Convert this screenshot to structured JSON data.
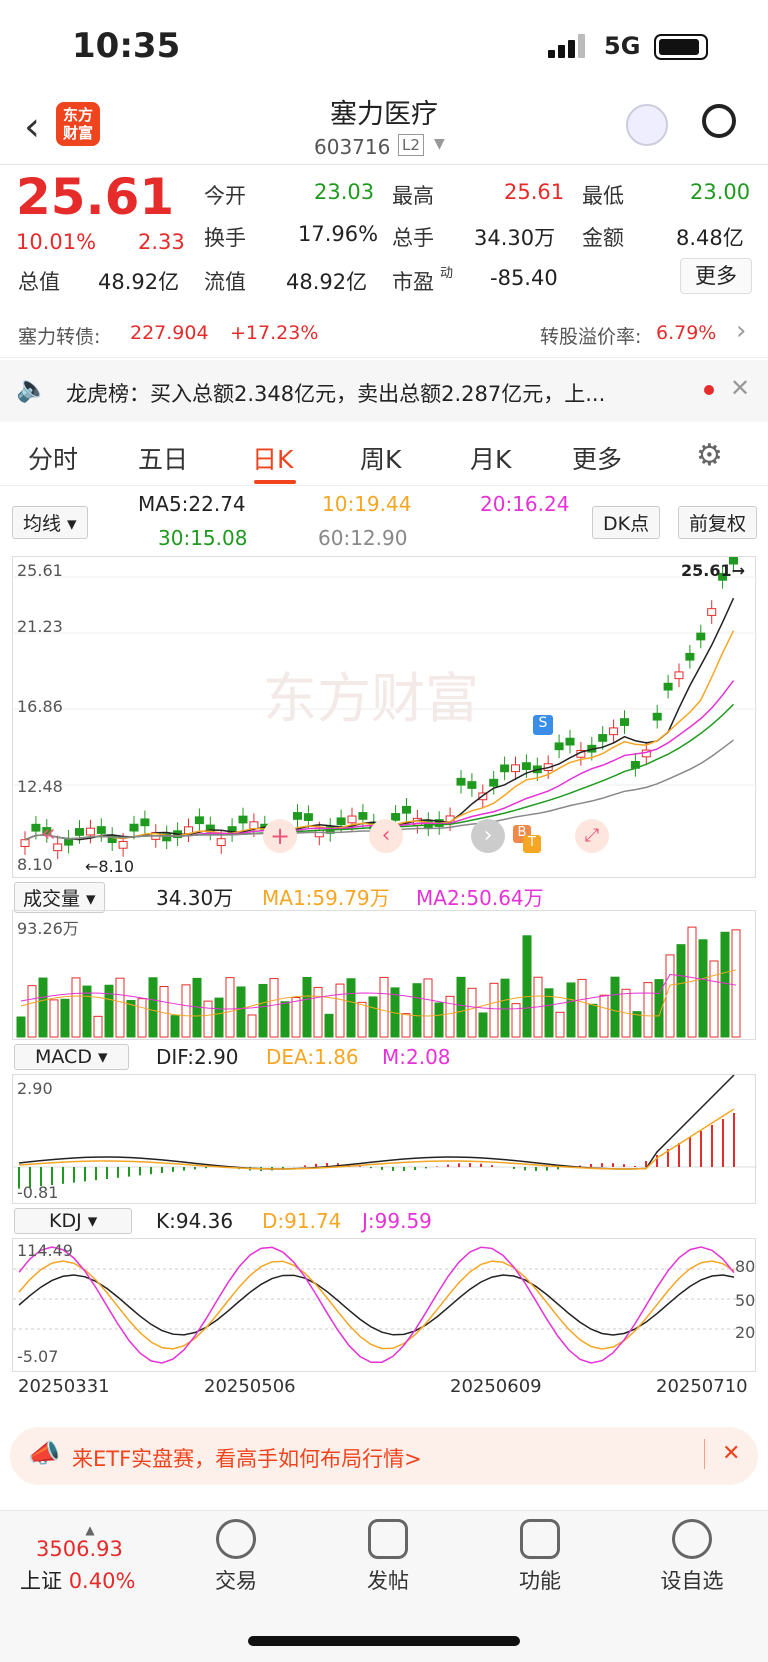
{
  "status": {
    "time": "10:35",
    "network": "5G"
  },
  "header": {
    "title": "塞力医疗",
    "code": "603716",
    "level": "L2",
    "logo": "东方财富",
    "robot_icon": "robot-avatar-icon"
  },
  "quote": {
    "price": "25.61",
    "pct": "10.01%",
    "chg": "2.33",
    "open_label": "今开",
    "open": "23.03",
    "high_label": "最高",
    "high": "25.61",
    "low_label": "最低",
    "low": "23.00",
    "turnover_label": "换手",
    "turnover": "17.96%",
    "vol_label": "总手",
    "vol": "34.30万",
    "amt_label": "金额",
    "amt": "8.48亿",
    "mcap_label": "总值",
    "mcap": "48.92亿",
    "float_label": "流值",
    "float": "48.92亿",
    "pe_label": "市盈",
    "pe_sup": "动",
    "pe": "-85.40",
    "more": "更多"
  },
  "bond": {
    "name": "塞力转债:",
    "price": "227.904",
    "pct": "+17.23%",
    "premium_label": "转股溢价率:",
    "premium": "6.79%"
  },
  "lhb": {
    "text": "龙虎榜：买入总额2.348亿元，卖出总额2.287亿元，上..."
  },
  "tabs": [
    "分时",
    "五日",
    "日K",
    "周K",
    "月K",
    "更多"
  ],
  "active_tab": "日K",
  "ma": {
    "selector": "均线",
    "ma5": "MA5:22.74",
    "ma10": "10:19.44",
    "ma20": "20:16.24",
    "ma30": "30:15.08",
    "ma60": "60:12.90",
    "dk": "DK点",
    "fq": "前复权"
  },
  "kline": {
    "axis": [
      "25.61",
      "21.23",
      "16.86",
      "12.48",
      "8.10"
    ],
    "max_label": "25.61",
    "min_label": "8.10",
    "watermark": "东方财富",
    "s_tag": "S",
    "b_tag": "B",
    "t_tag": "T"
  },
  "volume": {
    "selector": "成交量",
    "vol": "34.30万",
    "ma1": "MA1:59.79万",
    "ma2": "MA2:50.64万",
    "max": "93.26万"
  },
  "macd": {
    "selector": "MACD",
    "dif": "DIF:2.90",
    "dea": "DEA:1.86",
    "m": "M:2.08",
    "top": "2.90",
    "bottom": "-0.81"
  },
  "kdj": {
    "selector": "KDJ",
    "k": "K:94.36",
    "d": "D:91.74",
    "j": "J:99.59",
    "top": "114.49",
    "bottom": "-5.07",
    "l80": "80",
    "l50": "50",
    "l20": "20"
  },
  "dates": [
    "20250331",
    "20250506",
    "20250609",
    "20250710"
  ],
  "ad": {
    "text": "来ETF实盘赛，看高手如何布局行情>"
  },
  "nav": {
    "index_value": "3506.93",
    "index_name": "上证",
    "index_pct": "0.40%",
    "items": [
      "交易",
      "发帖",
      "功能",
      "设自选"
    ]
  },
  "colors": {
    "up": "#e62b2b",
    "down": "#1f9a1f",
    "accent": "#f0441e"
  }
}
